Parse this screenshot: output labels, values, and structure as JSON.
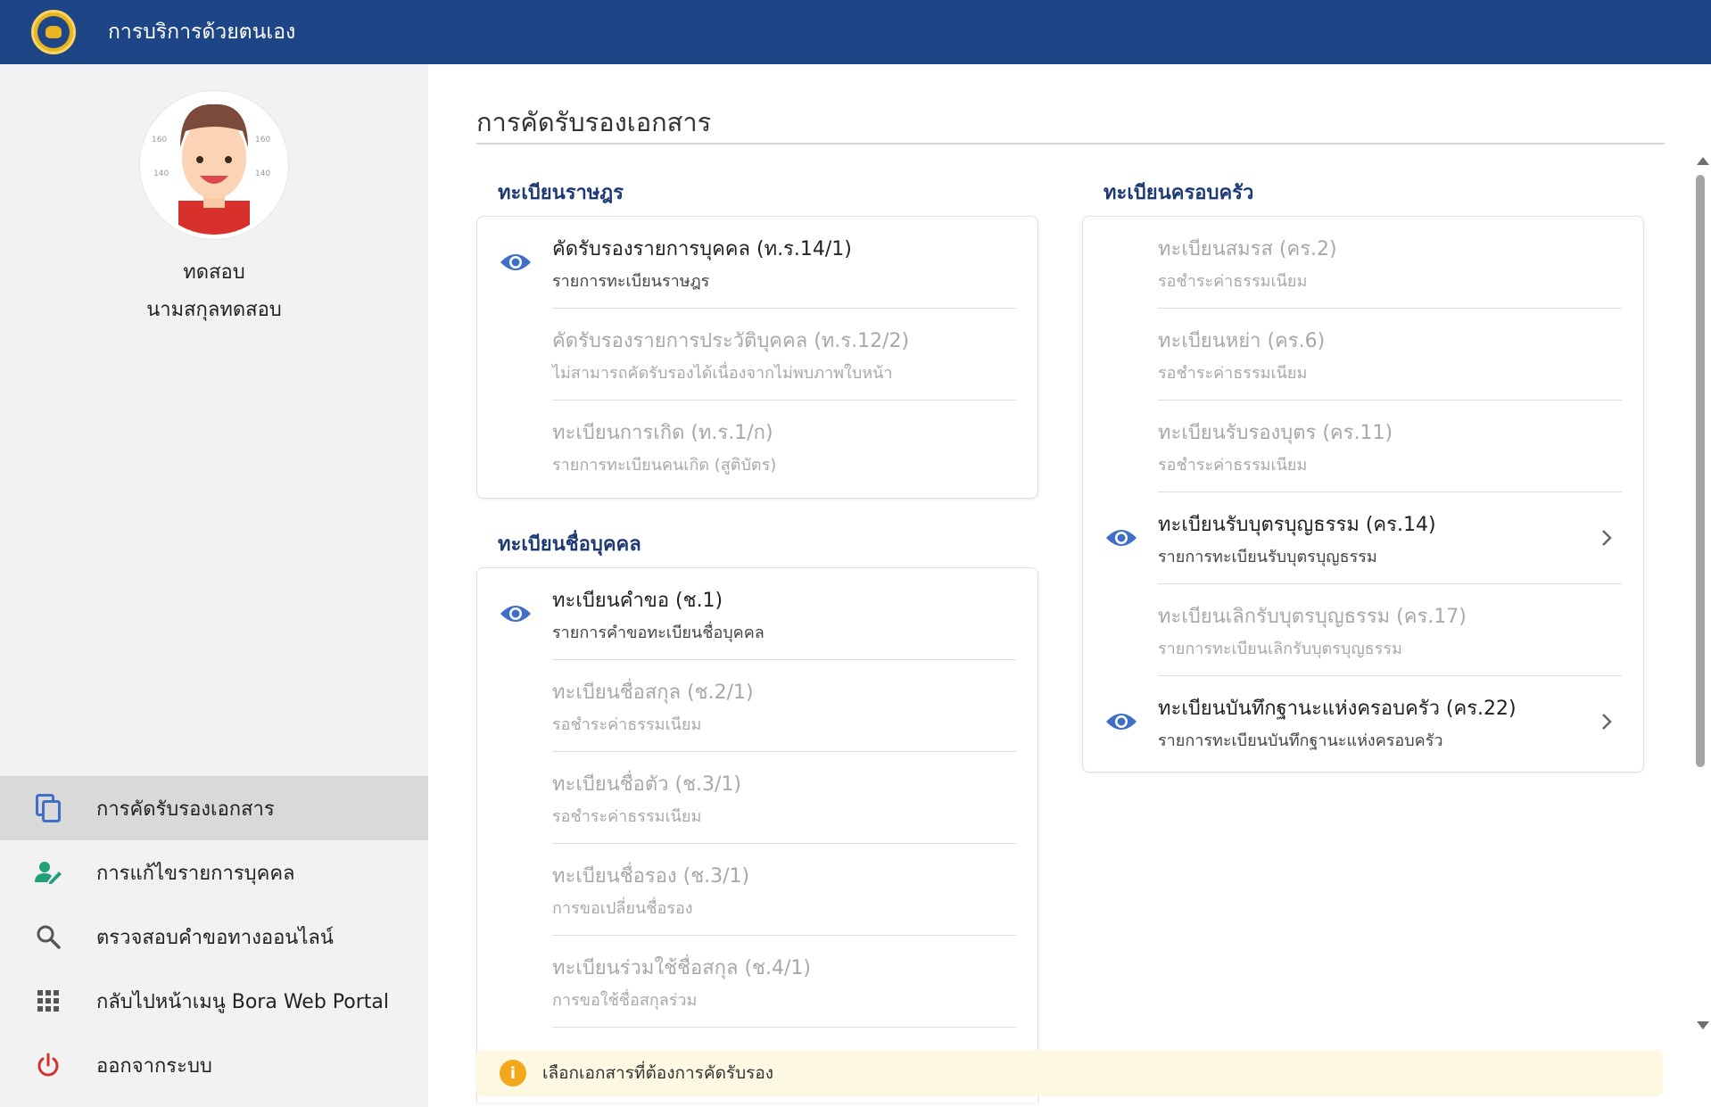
{
  "header": {
    "title": "การบริการด้วยตนเอง"
  },
  "user": {
    "first_name": "ทดสอบ",
    "last_name": "นามสกุลทดสอบ"
  },
  "avatar_marks": [
    "160",
    "160",
    "140",
    "140"
  ],
  "nav": [
    {
      "label": "การคัดรับรองเอกสาร",
      "icon": "copy-documents-icon",
      "active": true
    },
    {
      "label": "การแก้ไขรายการบุคคล",
      "icon": "edit-person-icon",
      "active": false
    },
    {
      "label": "ตรวจสอบคำขอทางออนไลน์",
      "icon": "search-icon",
      "active": false
    },
    {
      "label": "กลับไปหน้าเมนู Bora Web Portal",
      "icon": "apps-grid-icon",
      "active": false
    },
    {
      "label": "ออกจากระบบ",
      "icon": "power-icon",
      "active": false
    }
  ],
  "main": {
    "page_title": "การคัดรับรองเอกสาร",
    "sections": {
      "house_registration": {
        "title": "ทะเบียนราษฎร",
        "items": [
          {
            "title": "คัดรับรองรายการบุคคล (ท.ร.14/1)",
            "subtitle": "รายการทะเบียนราษฎร",
            "enabled": true,
            "eye": true,
            "chevron": false
          },
          {
            "title": "คัดรับรองรายการประวัติบุคคล (ท.ร.12/2)",
            "subtitle": "ไม่สามารถคัดรับรองได้เนื่องจากไม่พบภาพใบหน้า",
            "enabled": false,
            "eye": false,
            "chevron": false
          },
          {
            "title": "ทะเบียนการเกิด (ท.ร.1/ก)",
            "subtitle": "รายการทะเบียนคนเกิด (สูติบัตร)",
            "enabled": false,
            "eye": false,
            "chevron": false
          }
        ]
      },
      "name_registration": {
        "title": "ทะเบียนชื่อบุคคล",
        "items": [
          {
            "title": "ทะเบียนคำขอ (ช.1)",
            "subtitle": "รายการคำขอทะเบียนชื่อบุคคล",
            "enabled": true,
            "eye": true,
            "chevron": false
          },
          {
            "title": "ทะเบียนชื่อสกุล (ช.2/1)",
            "subtitle": "รอชำระค่าธรรมเนียม",
            "enabled": false,
            "eye": false,
            "chevron": false
          },
          {
            "title": "ทะเบียนชื่อตัว (ช.3/1)",
            "subtitle": "รอชำระค่าธรรมเนียม",
            "enabled": false,
            "eye": false,
            "chevron": false
          },
          {
            "title": "ทะเบียนชื่อรอง (ช.3/1)",
            "subtitle": "การขอเปลี่ยนชื่อรอง",
            "enabled": false,
            "eye": false,
            "chevron": false
          },
          {
            "title": "ทะเบียนร่วมใช้ชื่อสกุล (ช.4/1)",
            "subtitle": "การขอใช้ชื่อสกุลร่วม",
            "enabled": false,
            "eye": false,
            "chevron": false
          }
        ]
      },
      "family_registration": {
        "title": "ทะเบียนครอบครัว",
        "items": [
          {
            "title": "ทะเบียนสมรส (คร.2)",
            "subtitle": "รอชำระค่าธรรมเนียม",
            "enabled": false,
            "eye": false,
            "chevron": false
          },
          {
            "title": "ทะเบียนหย่า (คร.6)",
            "subtitle": "รอชำระค่าธรรมเนียม",
            "enabled": false,
            "eye": false,
            "chevron": false
          },
          {
            "title": "ทะเบียนรับรองบุตร (คร.11)",
            "subtitle": "รอชำระค่าธรรมเนียม",
            "enabled": false,
            "eye": false,
            "chevron": false
          },
          {
            "title": "ทะเบียนรับบุตรบุญธรรม (คร.14)",
            "subtitle": "รายการทะเบียนรับบุตรบุญธรรม",
            "enabled": true,
            "eye": true,
            "chevron": true
          },
          {
            "title": "ทะเบียนเลิกรับบุตรบุญธรรม (คร.17)",
            "subtitle": "รายการทะเบียนเลิกรับบุตรบุญธรรม",
            "enabled": false,
            "eye": false,
            "chevron": false
          },
          {
            "title": "ทะเบียนบันทึกฐานะแห่งครอบครัว (คร.22)",
            "subtitle": "รายการทะเบียนบันทึกฐานะแห่งครอบครัว",
            "enabled": true,
            "eye": true,
            "chevron": true
          }
        ]
      }
    },
    "notice": "เลือกเอกสารที่ต้องการคัดรับรอง"
  },
  "colors": {
    "header_bg": "#1e4585",
    "section_title": "#1e3a75",
    "eye_icon": "#3f6fc6",
    "copy_icon": "#3f6fc6",
    "edit_icon": "#22a07a",
    "power_icon": "#d2322d",
    "notice_bg": "#fdf8e1",
    "notice_icon": "#f3a81b"
  }
}
